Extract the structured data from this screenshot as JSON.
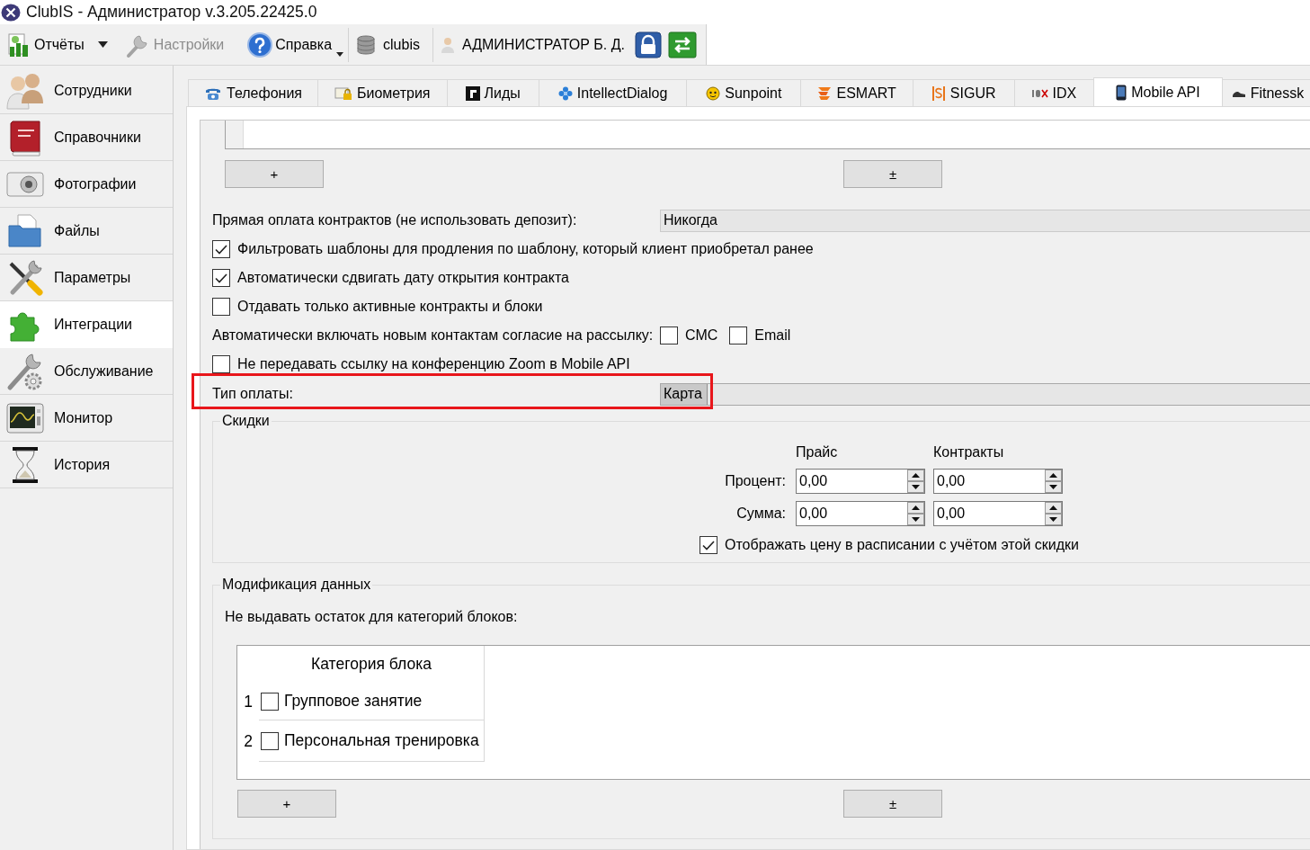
{
  "window": {
    "title": "ClubIS - Администратор v.3.205.22425.0"
  },
  "toolbar": {
    "groups": [
      [
        {
          "kind": "button",
          "label": "Отчёты",
          "disabled": false,
          "split_menu": true,
          "menu": false
        },
        {
          "kind": "button",
          "label": "Настройки",
          "disabled": true,
          "split_menu": false,
          "menu": false
        },
        {
          "kind": "button",
          "label": "Справка",
          "disabled": false,
          "split_menu": false,
          "menu": true
        }
      ],
      [
        {
          "kind": "label",
          "label": "clubis",
          "disabled": false
        }
      ],
      [
        {
          "kind": "label",
          "label": "АДМИНИСТРАТОР Б. Д.",
          "disabled": false
        },
        {
          "kind": "icon_button",
          "disabled": false
        },
        {
          "kind": "icon_button",
          "disabled": false
        }
      ]
    ]
  },
  "sidebar": {
    "items": [
      {
        "label": "Сотрудники",
        "selected": false
      },
      {
        "label": "Справочники",
        "selected": false
      },
      {
        "label": "Фотографии",
        "selected": false
      },
      {
        "label": "Файлы",
        "selected": false
      },
      {
        "label": "Параметры",
        "selected": false
      },
      {
        "label": "Интеграции",
        "selected": true
      },
      {
        "label": "Обслуживание",
        "selected": false
      },
      {
        "label": "Монитор",
        "selected": false
      },
      {
        "label": "История",
        "selected": false
      }
    ]
  },
  "tabs": [
    {
      "label": "Телефония",
      "selected": false
    },
    {
      "label": "Биометрия",
      "selected": false
    },
    {
      "label": "Лиды",
      "selected": false
    },
    {
      "label": "IntellectDialog",
      "selected": false
    },
    {
      "label": "Sunpoint",
      "selected": false
    },
    {
      "label": "ESMART",
      "selected": false
    },
    {
      "label": "SIGUR",
      "selected": false
    },
    {
      "label": "IDX",
      "selected": false
    },
    {
      "label": "Mobile API",
      "selected": true
    },
    {
      "label": "Fitnessk",
      "selected": false
    }
  ],
  "form": {
    "top_buttons": [
      "+",
      "±"
    ],
    "direct_payment": {
      "label": "Прямая оплата контрактов (не использовать депозит):",
      "value": "Никогда",
      "focused": false
    },
    "options": [
      {
        "label": "Фильтровать шаблоны для продления по шаблону, который клиент приобретал ранее",
        "checked": true
      },
      {
        "label": "Автоматически сдвигать дату открытия контракта",
        "checked": true
      },
      {
        "label": "Отдавать только активные контракты и блоки",
        "checked": false
      }
    ],
    "consent": {
      "label": "Автоматически включать новым контактам согласие на рассылку:",
      "channels": [
        {
          "label": "СМС",
          "checked": false
        },
        {
          "label": "Email",
          "checked": false
        }
      ]
    },
    "zoom_option": {
      "label": "Не передавать ссылку на конференцию Zoom в Mobile API",
      "checked": false
    },
    "payment_type": {
      "label": "Тип оплаты:",
      "value": "Карта",
      "focused": true,
      "highlighted": true
    },
    "discounts": {
      "title": "Скидки",
      "columns": [
        "Прайс",
        "Контракты"
      ],
      "rows": [
        {
          "label": "Процент:",
          "values": [
            "0,00",
            "0,00"
          ]
        },
        {
          "label": "Сумма:",
          "values": [
            "0,00",
            "0,00"
          ]
        }
      ],
      "show_in_schedule": {
        "label": "Отображать цену в расписании с учётом этой скидки",
        "checked": true
      }
    },
    "data_modification": {
      "title": "Модификация данных",
      "caption": "Не выдавать остаток для категорий блоков:",
      "table": {
        "columns": [
          "Категория блока"
        ],
        "rows": [
          {
            "number": "1",
            "label": "Групповое занятие",
            "checked": false
          },
          {
            "number": "2",
            "label": "Персональная тренировка",
            "checked": false
          }
        ]
      },
      "buttons": [
        "+",
        "±"
      ]
    }
  }
}
